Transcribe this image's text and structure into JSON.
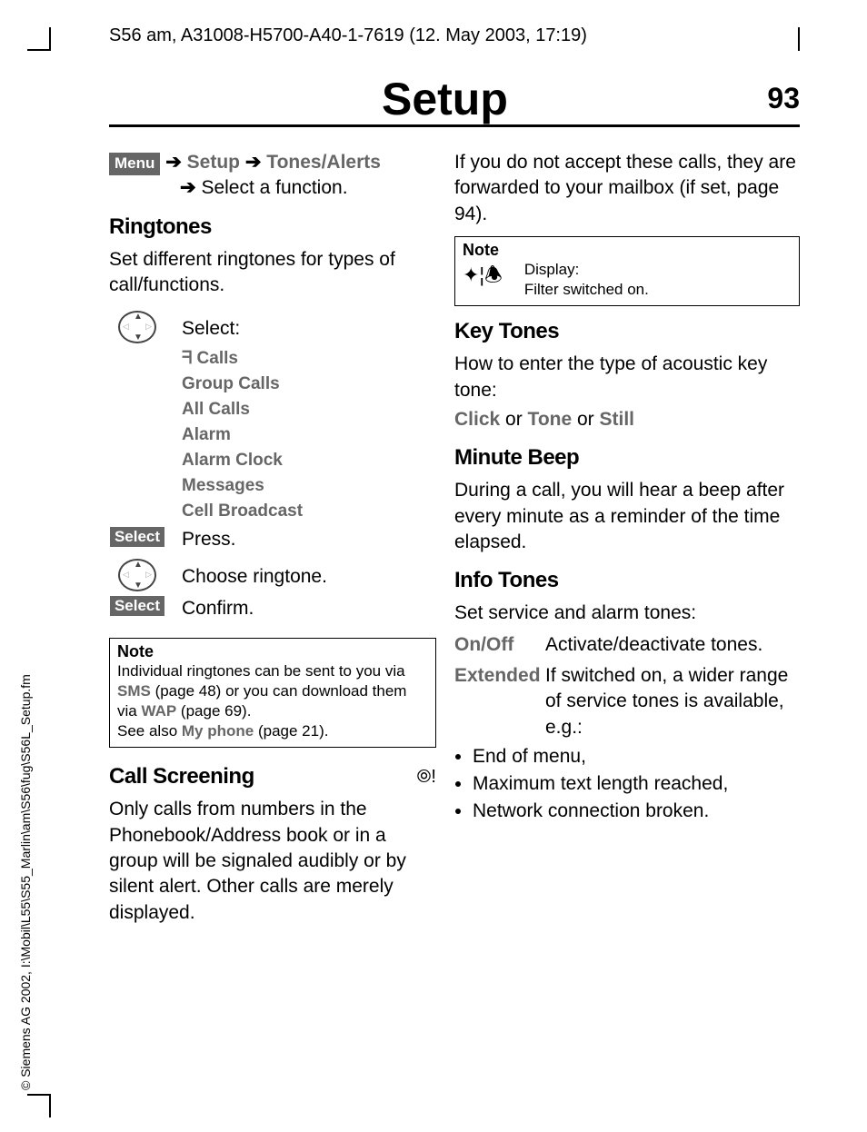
{
  "header": "S56 am, A31008-H5700-A40-1-7619 (12. May 2003, 17:19)",
  "copyright": "© Siemens AG 2002, I:\\Mobil\\L55\\S55_Marlin\\am\\S56\\fug\\S56L_Setup.fm",
  "title": "Setup",
  "page_number": "93",
  "left": {
    "menu_label": "Menu",
    "breadcrumb1": "Setup",
    "breadcrumb2": "Tones/Alerts",
    "breadcrumb3": "Select a function.",
    "ringtones": {
      "heading": "Ringtones",
      "desc": "Set different ringtones for types of call/functions.",
      "select_label": "Select:",
      "items": [
        "Calls",
        "Group Calls",
        "All Calls",
        "Alarm",
        "Alarm Clock",
        "Messages",
        "Cell Broadcast"
      ],
      "antenna_prefix": "ᖷ",
      "press": "Press.",
      "choose": "Choose ringtone.",
      "confirm": "Confirm.",
      "select_btn": "Select"
    },
    "note": {
      "title": "Note",
      "line1a": "Individual ringtones can be sent to you via ",
      "sms": "SMS",
      "line1b": " (page 48) or you can download them via ",
      "wap": "WAP",
      "line1c": " (page 69).",
      "line2a": "See also ",
      "myphone": "My phone",
      "line2b": " (page 21)."
    },
    "call_screening": {
      "heading": "Call Screening",
      "desc": "Only calls from numbers in the Phonebook/Address book or in a group will be signaled audibly or by silent alert. Other calls are merely displayed."
    }
  },
  "right": {
    "forward_text": "If you do not accept these calls, they are forwarded to your mailbox (if set, page 94).",
    "note": {
      "title": "Note",
      "display_label": "Display:",
      "display_text": "Filter switched on."
    },
    "key_tones": {
      "heading": "Key Tones",
      "desc": "How to enter the type of acoustic key tone:",
      "opt1": "Click",
      "or1": " or ",
      "opt2": "Tone",
      "or2": " or ",
      "opt3": "Still"
    },
    "minute_beep": {
      "heading": "Minute Beep",
      "desc": "During a call, you will hear a beep after every minute as a reminder of the time elapsed."
    },
    "info_tones": {
      "heading": "Info Tones",
      "desc": "Set service and alarm tones:",
      "onoff_label": "On/Off",
      "onoff_text": "Activate/deactivate tones.",
      "ext_label": "Extended",
      "ext_text": "If switched on, a wider range of service tones is available, e.g.:",
      "bullets": [
        "End of menu,",
        "Maximum text length reached,",
        "Network connection broken."
      ]
    }
  }
}
